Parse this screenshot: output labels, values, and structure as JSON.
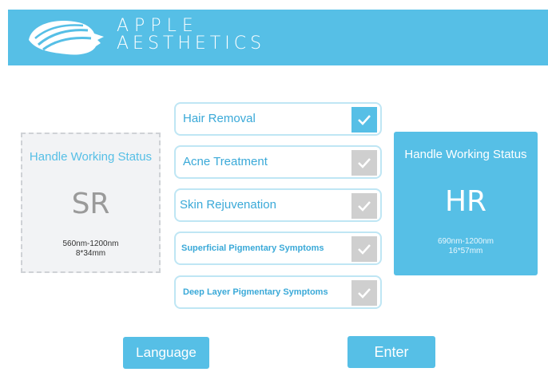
{
  "header": {
    "brand_line1": "APPLE",
    "brand_line2": "AESTHETICS",
    "logo_icon": "profile-logo-icon"
  },
  "left_panel": {
    "title": "Handle Working Status",
    "mode": "SR",
    "wavelength": "560nm-1200nm",
    "spot_size": "8*34mm"
  },
  "right_panel": {
    "title": "Handle Working Status",
    "mode": "HR",
    "wavelength": "690nm-1200nm",
    "spot_size": "16*57mm"
  },
  "options": [
    {
      "label": "Hair Removal",
      "checked": true
    },
    {
      "label": "Acne Treatment",
      "checked": false
    },
    {
      "label": "Skin Rejuvenation",
      "checked": false
    },
    {
      "label": "Superficial Pigmentary Symptoms",
      "checked": false
    },
    {
      "label": "Deep Layer Pigmentary Symptoms",
      "checked": false
    }
  ],
  "buttons": {
    "language": "Language",
    "enter": "Enter"
  },
  "colors": {
    "accent": "#56bfe6",
    "unchecked": "#cfcfcf"
  }
}
